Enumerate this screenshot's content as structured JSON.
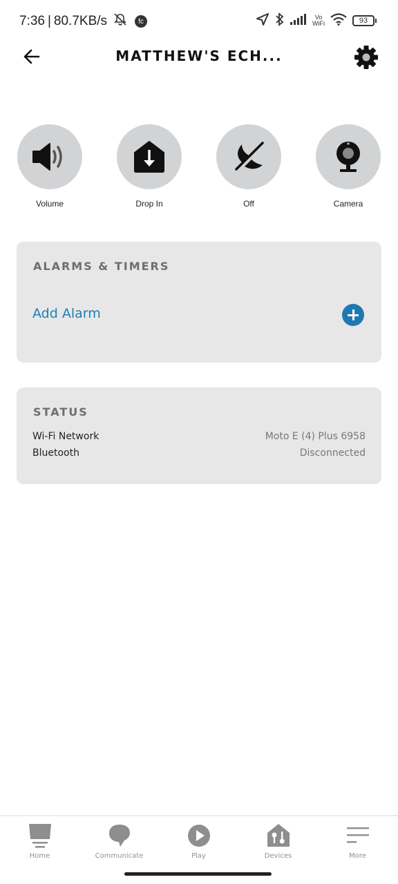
{
  "status_bar": {
    "time": "7:36",
    "separator": "|",
    "net_speed": "80.7KB/s",
    "fc_badge": "fc",
    "vowifi_top": "Vo",
    "vowifi_bottom": "WiFi",
    "battery": "93",
    "icons": [
      "bell-off-icon",
      "location-icon",
      "bluetooth-icon",
      "signal-icon",
      "wifi-icon",
      "battery-icon"
    ]
  },
  "header": {
    "title": "MATTHEW'S ECH...",
    "back_icon": "arrow-left-icon",
    "settings_icon": "gear-icon"
  },
  "quick_actions": [
    {
      "label": "Volume",
      "icon": "speaker-icon"
    },
    {
      "label": "Drop In",
      "icon": "drop-in-icon"
    },
    {
      "label": "Off",
      "icon": "do-not-disturb-off-icon"
    },
    {
      "label": "Camera",
      "icon": "camera-icon"
    }
  ],
  "alarms_card": {
    "title": "ALARMS & TIMERS",
    "add_label": "Add Alarm",
    "accent": "#1e7fb0"
  },
  "status_card": {
    "title": "STATUS",
    "rows": [
      {
        "key": "Wi-Fi Network",
        "value": "Moto E (4) Plus 6958"
      },
      {
        "key": "Bluetooth",
        "value": "Disconnected"
      }
    ]
  },
  "bottom_nav": [
    {
      "label": "Home",
      "icon": "home-icon"
    },
    {
      "label": "Communicate",
      "icon": "chat-bubble-icon"
    },
    {
      "label": "Play",
      "icon": "play-icon"
    },
    {
      "label": "Devices",
      "icon": "devices-icon"
    },
    {
      "label": "More",
      "icon": "menu-icon"
    }
  ]
}
